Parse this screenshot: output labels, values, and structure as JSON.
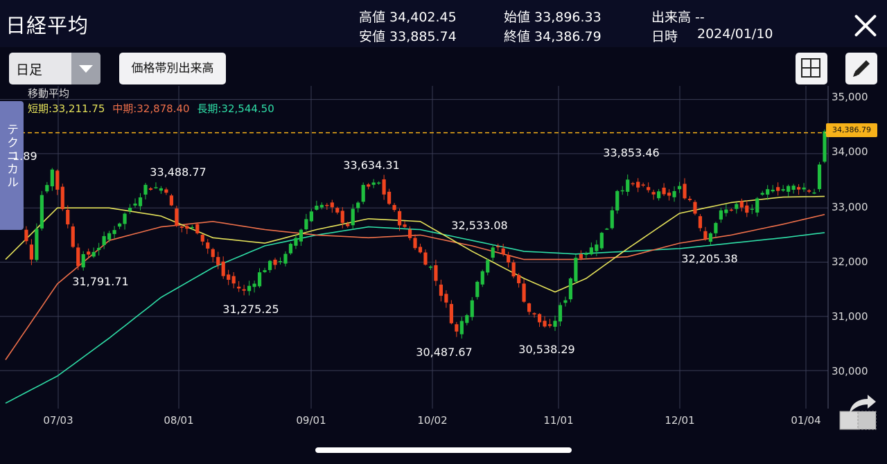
{
  "header": {
    "title": "日経平均",
    "high": "高値 34,402.45",
    "low": "安値 33,885.74",
    "open": "始値 33,896.33",
    "close": "終値 34,386.79",
    "volume": "出来高 --",
    "date_label": "日時",
    "date_value": "2024/01/10"
  },
  "toolbar": {
    "period_select": "日足",
    "volume_by_price_button": "価格帯別出来高"
  },
  "side_tab": {
    "label": "テクニカル",
    "value": "1.89"
  },
  "moving_average": {
    "title": "移動平均",
    "short": "短期:33,211.75",
    "mid": "中期:32,878.40",
    "long": "長期:32,544.50",
    "colors": {
      "short": "#e6e35a",
      "mid": "#f0704a",
      "long": "#2fe0a8"
    }
  },
  "colors": {
    "up": "#1fbf3f",
    "down": "#f0441f",
    "dash": "#f7b21a",
    "grid": "#3a3c55"
  },
  "last_price_label": "34,386.79",
  "chart_data": {
    "type": "candlestick",
    "title": "",
    "x_ticks": [
      "07/03",
      "08/01",
      "09/01",
      "10/02",
      "11/01",
      "12/01",
      "01/04"
    ],
    "y_ticks": [
      "35,000",
      "34,000",
      "33,000",
      "32,000",
      "31,000",
      "30,000"
    ],
    "ylim": [
      29300,
      35250
    ],
    "last_close": 34386.79,
    "annotations": [
      {
        "label": "33,488.77",
        "date": "07/31",
        "kind": "high"
      },
      {
        "label": "31,791.71",
        "date": "07/12",
        "kind": "low"
      },
      {
        "label": "31,275.25",
        "date": "08/22",
        "kind": "low"
      },
      {
        "label": "33,634.31",
        "date": "09/15",
        "kind": "high"
      },
      {
        "label": "30,487.67",
        "date": "10/04",
        "kind": "low"
      },
      {
        "label": "32,533.08",
        "date": "10/12",
        "kind": "high"
      },
      {
        "label": "30,538.29",
        "date": "10/30",
        "kind": "low"
      },
      {
        "label": "33,853.46",
        "date": "11/20",
        "kind": "high"
      },
      {
        "label": "32,205.38",
        "date": "12/13",
        "kind": "low"
      }
    ],
    "close_anchors": [
      [
        0,
        33400
      ],
      [
        5,
        32100
      ],
      [
        7,
        33250
      ],
      [
        9,
        33700
      ],
      [
        14,
        32000
      ],
      [
        18,
        32300
      ],
      [
        22,
        32750
      ],
      [
        27,
        33400
      ],
      [
        31,
        33350
      ],
      [
        33,
        32650
      ],
      [
        37,
        32600
      ],
      [
        42,
        31750
      ],
      [
        46,
        31450
      ],
      [
        50,
        31900
      ],
      [
        54,
        32100
      ],
      [
        58,
        32800
      ],
      [
        60,
        33100
      ],
      [
        63,
        32950
      ],
      [
        66,
        32700
      ],
      [
        69,
        33350
      ],
      [
        72,
        33450
      ],
      [
        75,
        32900
      ],
      [
        79,
        32300
      ],
      [
        82,
        31900
      ],
      [
        85,
        31200
      ],
      [
        87,
        30700
      ],
      [
        89,
        31100
      ],
      [
        92,
        31900
      ],
      [
        94,
        32300
      ],
      [
        96,
        32150
      ],
      [
        98,
        31800
      ],
      [
        101,
        31100
      ],
      [
        103,
        30900
      ],
      [
        105,
        30750
      ],
      [
        108,
        31350
      ],
      [
        110,
        32100
      ],
      [
        113,
        32250
      ],
      [
        116,
        32650
      ],
      [
        118,
        33350
      ],
      [
        120,
        33450
      ],
      [
        124,
        33300
      ],
      [
        127,
        33200
      ],
      [
        130,
        33350
      ],
      [
        132,
        33150
      ],
      [
        135,
        32450
      ],
      [
        138,
        32900
      ],
      [
        141,
        33050
      ],
      [
        143,
        32900
      ],
      [
        146,
        33200
      ],
      [
        148,
        33400
      ],
      [
        150,
        33350
      ],
      [
        153,
        33400
      ],
      [
        156,
        33300
      ],
      [
        158,
        34386.79
      ]
    ],
    "ma_short": [
      [
        0,
        32050
      ],
      [
        10,
        33000
      ],
      [
        20,
        33000
      ],
      [
        30,
        32850
      ],
      [
        40,
        32450
      ],
      [
        50,
        32350
      ],
      [
        60,
        32600
      ],
      [
        70,
        32800
      ],
      [
        80,
        32750
      ],
      [
        90,
        32200
      ],
      [
        100,
        31700
      ],
      [
        106,
        31450
      ],
      [
        112,
        31700
      ],
      [
        120,
        32250
      ],
      [
        130,
        32900
      ],
      [
        140,
        33100
      ],
      [
        150,
        33200
      ],
      [
        158,
        33211.75
      ]
    ],
    "ma_mid": [
      [
        0,
        30200
      ],
      [
        10,
        31600
      ],
      [
        20,
        32400
      ],
      [
        30,
        32650
      ],
      [
        40,
        32750
      ],
      [
        50,
        32600
      ],
      [
        60,
        32500
      ],
      [
        70,
        32450
      ],
      [
        80,
        32500
      ],
      [
        90,
        32300
      ],
      [
        100,
        32050
      ],
      [
        110,
        32050
      ],
      [
        120,
        32100
      ],
      [
        130,
        32350
      ],
      [
        140,
        32500
      ],
      [
        150,
        32700
      ],
      [
        158,
        32878.4
      ]
    ],
    "ma_long": [
      [
        0,
        29400
      ],
      [
        10,
        29900
      ],
      [
        20,
        30600
      ],
      [
        30,
        31350
      ],
      [
        40,
        31900
      ],
      [
        50,
        32300
      ],
      [
        60,
        32500
      ],
      [
        70,
        32650
      ],
      [
        80,
        32600
      ],
      [
        90,
        32400
      ],
      [
        100,
        32200
      ],
      [
        110,
        32150
      ],
      [
        120,
        32200
      ],
      [
        130,
        32250
      ],
      [
        140,
        32350
      ],
      [
        150,
        32450
      ],
      [
        158,
        32544.5
      ]
    ]
  }
}
